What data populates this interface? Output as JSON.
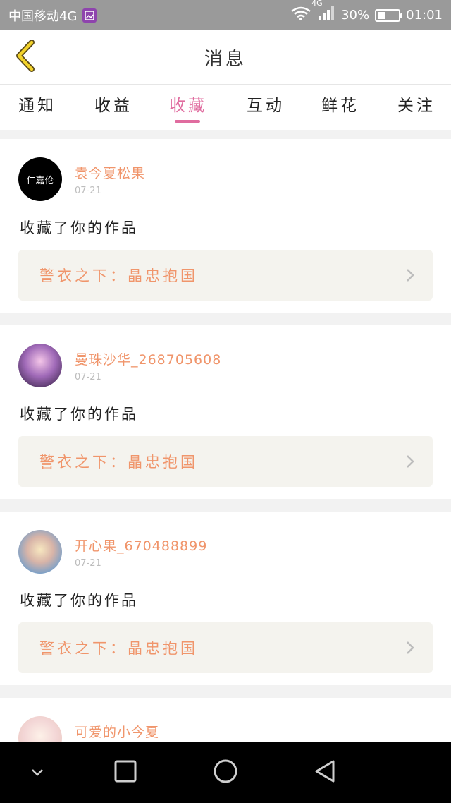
{
  "status_bar": {
    "carrier": "中国移动4G",
    "network": "4G",
    "battery_percent": "30%",
    "battery_level": 0.3,
    "time": "01:01"
  },
  "header": {
    "title": "消息",
    "back_icon": "chevron-left-icon"
  },
  "tabs": [
    {
      "label": "通知",
      "active": false
    },
    {
      "label": "收益",
      "active": false
    },
    {
      "label": "收藏",
      "active": true
    },
    {
      "label": "互动",
      "active": false
    },
    {
      "label": "鲜花",
      "active": false
    },
    {
      "label": "关注",
      "active": false
    }
  ],
  "colors": {
    "accent": "#e06c9f",
    "username": "#f0956b",
    "work_box_bg": "#f4f3ee",
    "status_bar_bg": "#9a9a9a"
  },
  "messages": [
    {
      "username": "袁今夏松果",
      "date": "07-21",
      "text": "收藏了你的作品",
      "work_title": "警衣之下：晶忠抱国",
      "avatar_text": "仁嘉伦"
    },
    {
      "username": "曼珠沙华_268705608",
      "date": "07-21",
      "text": "收藏了你的作品",
      "work_title": "警衣之下：晶忠抱国"
    },
    {
      "username": "开心果_670488899",
      "date": "07-21",
      "text": "收藏了你的作品",
      "work_title": "警衣之下：晶忠抱国"
    },
    {
      "username": "可爱的小今夏"
    }
  ],
  "nav_bar": {
    "icons": [
      "chevron-down-icon",
      "square-icon",
      "circle-icon",
      "triangle-back-icon"
    ]
  }
}
